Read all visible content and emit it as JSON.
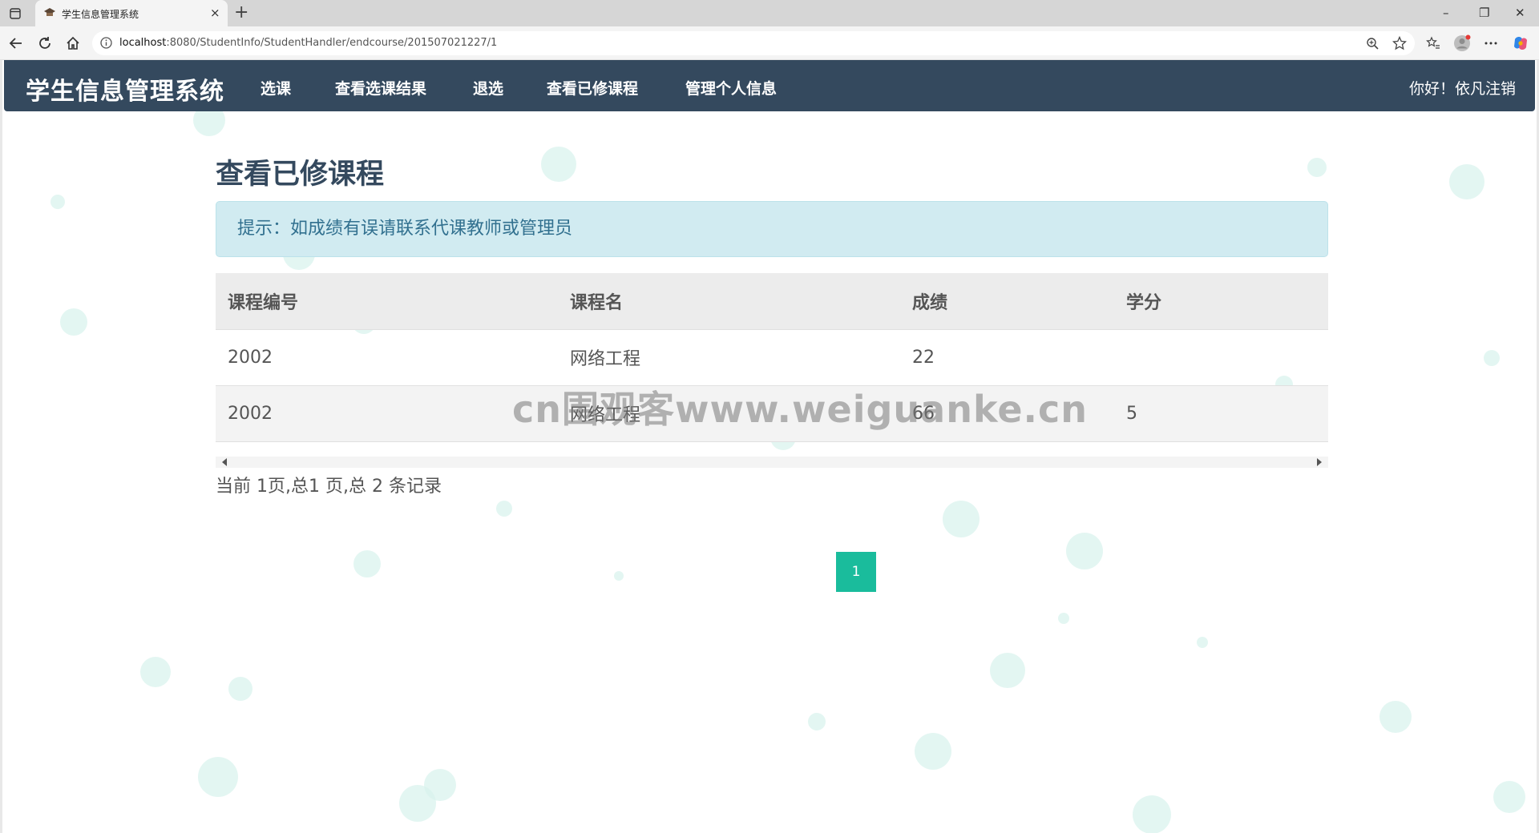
{
  "browser": {
    "tab_title": "学生信息管理系统",
    "tab_close": "×",
    "new_tab": "+",
    "url_host": "localhost",
    "url_path": ":8080/StudentInfo/StudentHandler/endcourse/201507021227/1",
    "minimize": "–",
    "restore": "❐",
    "close": "✕"
  },
  "navbar": {
    "brand": "学生信息管理系统",
    "links": [
      "选课",
      "查看选课结果",
      "退选",
      "查看已修课程",
      "管理个人信息"
    ],
    "greeting": "你好！依凡注销"
  },
  "main": {
    "heading": "查看已修课程",
    "alert": "提示：如成绩有误请联系代课教师或管理员",
    "columns": [
      "课程编号",
      "课程名",
      "成绩",
      "学分"
    ],
    "rows": [
      [
        "2002",
        "网络工程",
        "22",
        ""
      ],
      [
        "2002",
        "网络工程",
        "66",
        "5"
      ]
    ],
    "page_info": "当前 1页,总1 页,总 2 条记录",
    "current_page": "1"
  },
  "watermark": "cn围观客www.weiguanke.cn",
  "colors": {
    "navbar": "#34495e",
    "accent": "#1abc9c",
    "alert_bg": "#d1ebf1",
    "alert_text": "#31708f"
  }
}
